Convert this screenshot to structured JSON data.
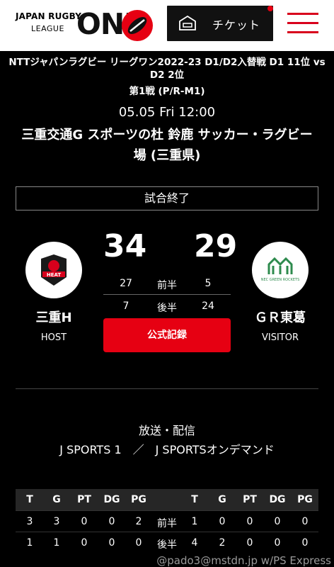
{
  "header": {
    "logo_line1": "JAPAN RUGBY",
    "logo_line2": "LEAGUE",
    "logo_main": "ONE",
    "ticket_label": "チケット",
    "ticket_icon": "ticket-icon",
    "menu_icon": "hamburger-menu-icon",
    "accent_color": "#e60012"
  },
  "match": {
    "title": "NTTジャパンラグビー リーグワン2022-23 D1/D2入替戦 D1 11位 vs D2 2位",
    "round": "第1戦 (P/R-M1)",
    "datetime": "05.05 Fri 12:00",
    "venue": "三重交通G スポーツの杜 鈴鹿 サッカー・ラグビー場 (三重県)",
    "status": "試合終了"
  },
  "score": {
    "home": {
      "name": "三重H",
      "role": "HOST",
      "total": "34",
      "first_half": "27",
      "second_half": "7",
      "logo_text": "HEAT"
    },
    "away": {
      "name": "ＧＲ東葛",
      "role": "VISITOR",
      "total": "29",
      "first_half": "5",
      "second_half": "24",
      "logo_text": "NEC GREEN ROCKETS"
    },
    "first_half_label": "前半",
    "second_half_label": "後半",
    "official_record_label": "公式記録"
  },
  "broadcast": {
    "title": "放送・配信",
    "channels": "J SPORTS 1　／　J SPORTSオンデマンド"
  },
  "stats": {
    "headers": [
      "T",
      "G",
      "PT",
      "DG",
      "PG",
      "",
      "T",
      "G",
      "PT",
      "DG",
      "PG"
    ],
    "rows": [
      [
        "3",
        "3",
        "0",
        "0",
        "2",
        "前半",
        "1",
        "0",
        "0",
        "0",
        "0"
      ],
      [
        "1",
        "1",
        "0",
        "0",
        "0",
        "後半",
        "4",
        "2",
        "0",
        "0",
        "0"
      ]
    ]
  },
  "watermark": "@pado3@mstdn.jp w/PS Express"
}
